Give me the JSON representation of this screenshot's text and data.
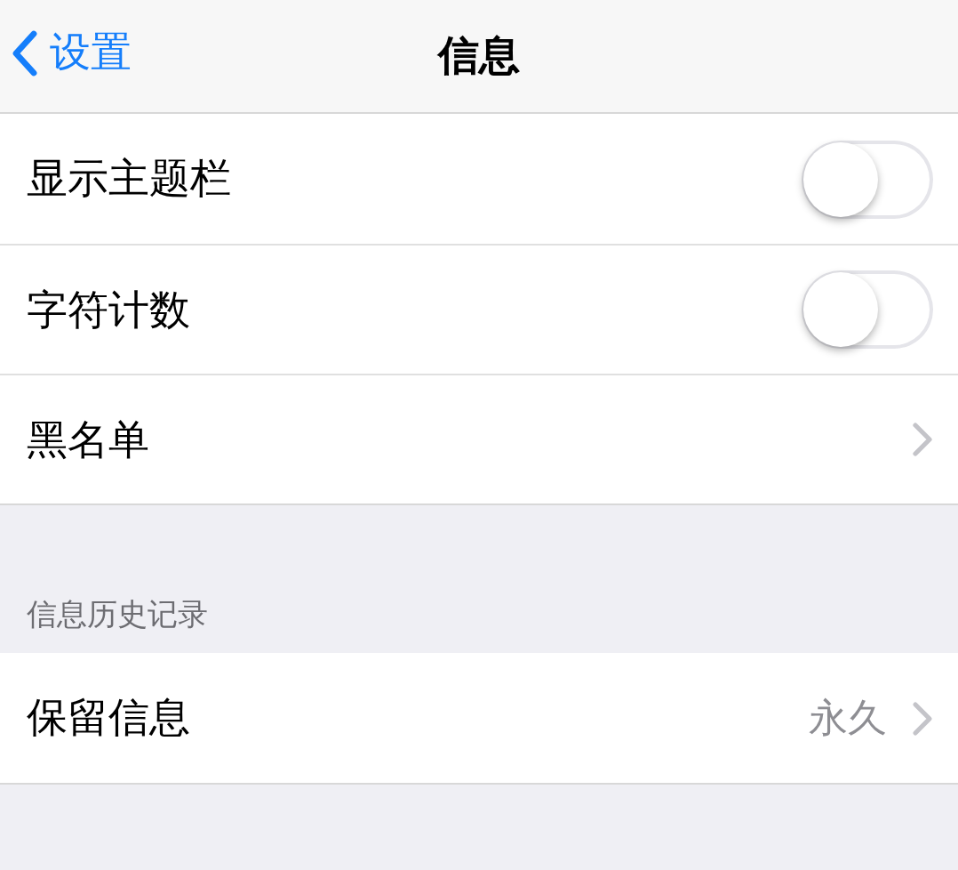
{
  "nav": {
    "back": "设置",
    "title": "信息"
  },
  "sections": [
    {
      "rows": [
        {
          "kind": "toggle",
          "label": "显示主题栏",
          "on": false
        },
        {
          "kind": "toggle",
          "label": "字符计数",
          "on": false
        },
        {
          "kind": "link",
          "label": "黑名单"
        }
      ]
    },
    {
      "header": "信息历史记录",
      "rows": [
        {
          "kind": "link",
          "label": "保留信息",
          "value": "永久"
        }
      ]
    }
  ]
}
